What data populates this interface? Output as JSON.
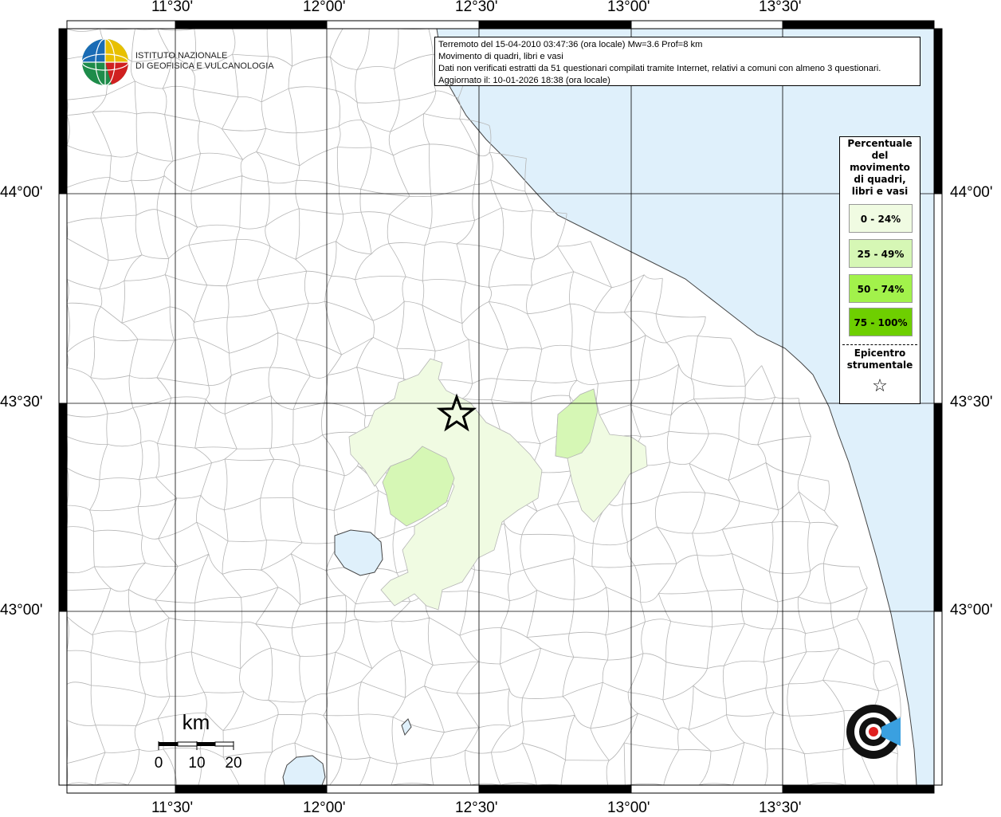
{
  "info": {
    "line1": "Terremoto del 15-04-2010 03:47:36 (ora locale) Mw=3.6 Prof=8 km",
    "line2": "Movimento di quadri, libri e vasi",
    "line3": "Dati non verificati estratti da 51 questionari compilati tramite Internet, relativi a comuni con almeno 3 questionari.",
    "line4": "Aggiornato il: 10-01-2026 18:38 (ora locale)"
  },
  "legend": {
    "title": [
      "Percentuale",
      "del",
      "movimento",
      "di quadri,",
      "libri e vasi"
    ],
    "classes": [
      {
        "label": "0 - 24%",
        "color": "#f0fbe2"
      },
      {
        "label": "25 - 49%",
        "color": "#d6f7b5"
      },
      {
        "label": "50 - 74%",
        "color": "#a2f24b"
      },
      {
        "label": "75 - 100%",
        "color": "#6ecf00"
      }
    ],
    "epicenter": [
      "Epicentro",
      "strumentale"
    ],
    "epicenter_symbol": "☆"
  },
  "axes": {
    "top": [
      "11°30'",
      "12°00'",
      "12°30'",
      "13°00'",
      "13°30'"
    ],
    "bottom": [
      "11°30'",
      "12°00'",
      "12°30'",
      "13°00'",
      "13°30'"
    ],
    "left": [
      "44°00'",
      "43°30'",
      "43°00'"
    ],
    "right": [
      "44°00'",
      "43°30'",
      "43°00'"
    ]
  },
  "scale": {
    "unit": "km",
    "ticks": [
      "0",
      "10",
      "20"
    ]
  },
  "logo": {
    "line1": "ISTITUTO NAZIONALE",
    "line2": "DI GEOFISICA E VULCANOLOGIA"
  },
  "colors": {
    "sea": "#dff0fb",
    "border": "#aaaaaa",
    "grid": "#000000"
  }
}
